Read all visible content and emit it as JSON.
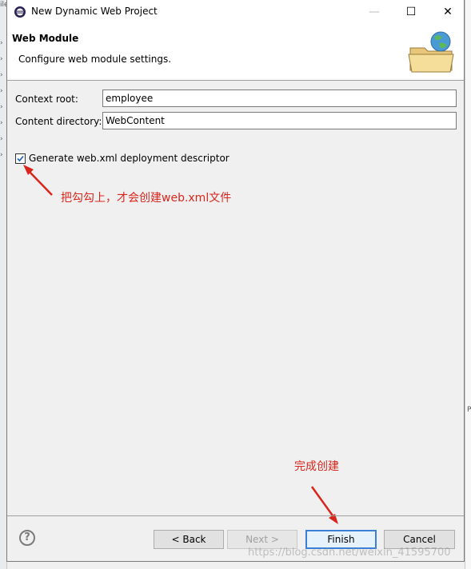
{
  "window": {
    "title": "New Dynamic Web Project",
    "minimize_glyph": "—",
    "maximize_glyph": "☐",
    "close_glyph": "✕"
  },
  "header": {
    "title": "Web Module",
    "description": "Configure web module settings."
  },
  "form": {
    "context_root": {
      "label": "Context root:",
      "value": "employee"
    },
    "content_directory": {
      "label": "Content directory:",
      "value": "WebContent"
    },
    "generate_descriptor": {
      "label": "Generate web.xml deployment descriptor",
      "checked": true
    }
  },
  "annotations": {
    "checkbox_note": "把勾勾上，才会创建web.xml文件",
    "finish_note": "完成创建",
    "color": "#d9261c"
  },
  "buttons": {
    "help": "?",
    "back": "< Back",
    "next": "Next >",
    "finish": "Finish",
    "cancel": "Cancel"
  },
  "watermark": "https://blog.csdn.net/weixin_41595700",
  "background": {
    "left_marks": [
      "ile",
      "›",
      "›",
      "›",
      "›",
      "›",
      "›",
      "›",
      "›"
    ],
    "right_mark": "PI"
  }
}
